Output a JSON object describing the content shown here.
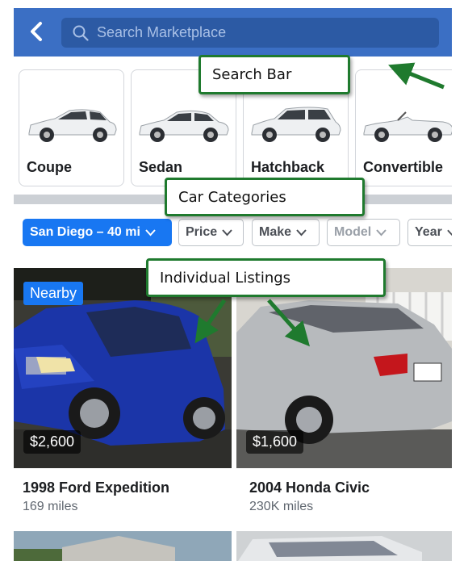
{
  "header": {
    "search_placeholder": "Search Marketplace",
    "brand_color": "#3b6fc4"
  },
  "categories": [
    {
      "label": "Coupe",
      "icon": "car-coupe-image"
    },
    {
      "label": "Sedan",
      "icon": "car-sedan-image"
    },
    {
      "label": "Hatchback",
      "icon": "car-hatchback-image"
    },
    {
      "label": "Convertible",
      "icon": "car-convertible-image"
    }
  ],
  "filters": {
    "location": "San Diego – 40 mi",
    "price": "Price",
    "make": "Make",
    "model": "Model",
    "year": "Year"
  },
  "listings": [
    {
      "badge": "Nearby",
      "price": "$2,600",
      "title": "1998 Ford Expedition",
      "subtitle": "169 miles"
    },
    {
      "badge": "",
      "price": "$1,600",
      "title": "2004 Honda Civic",
      "subtitle": "230K miles"
    }
  ],
  "annotations": {
    "search_bar": "Search Bar",
    "car_categories": "Car Categories",
    "individual_listings": "Individual Listings",
    "annotation_color": "#1f7a2e"
  },
  "colors": {
    "accent": "#1877f2",
    "ford_paint": "#1b35a8",
    "civic_paint": "#b7babd"
  }
}
